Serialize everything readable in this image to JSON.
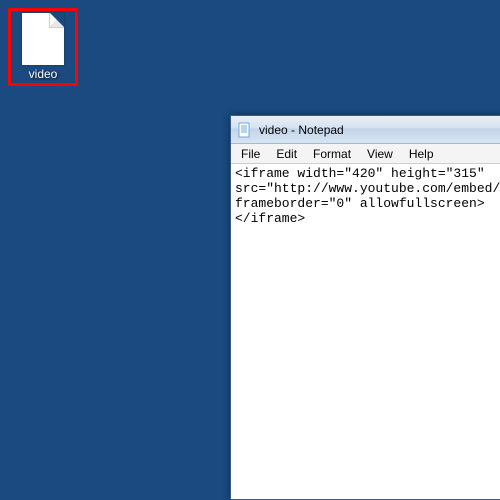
{
  "desktop": {
    "icon_label": "video"
  },
  "notepad": {
    "title": "video - Notepad",
    "menu": {
      "file": "File",
      "edit": "Edit",
      "format": "Format",
      "view": "View",
      "help": "Help"
    },
    "content": "<iframe width=\"420\" height=\"315\"\nsrc=\"http://www.youtube.com/embed/g\nframeborder=\"0\" allowfullscreen>\n</iframe>"
  }
}
